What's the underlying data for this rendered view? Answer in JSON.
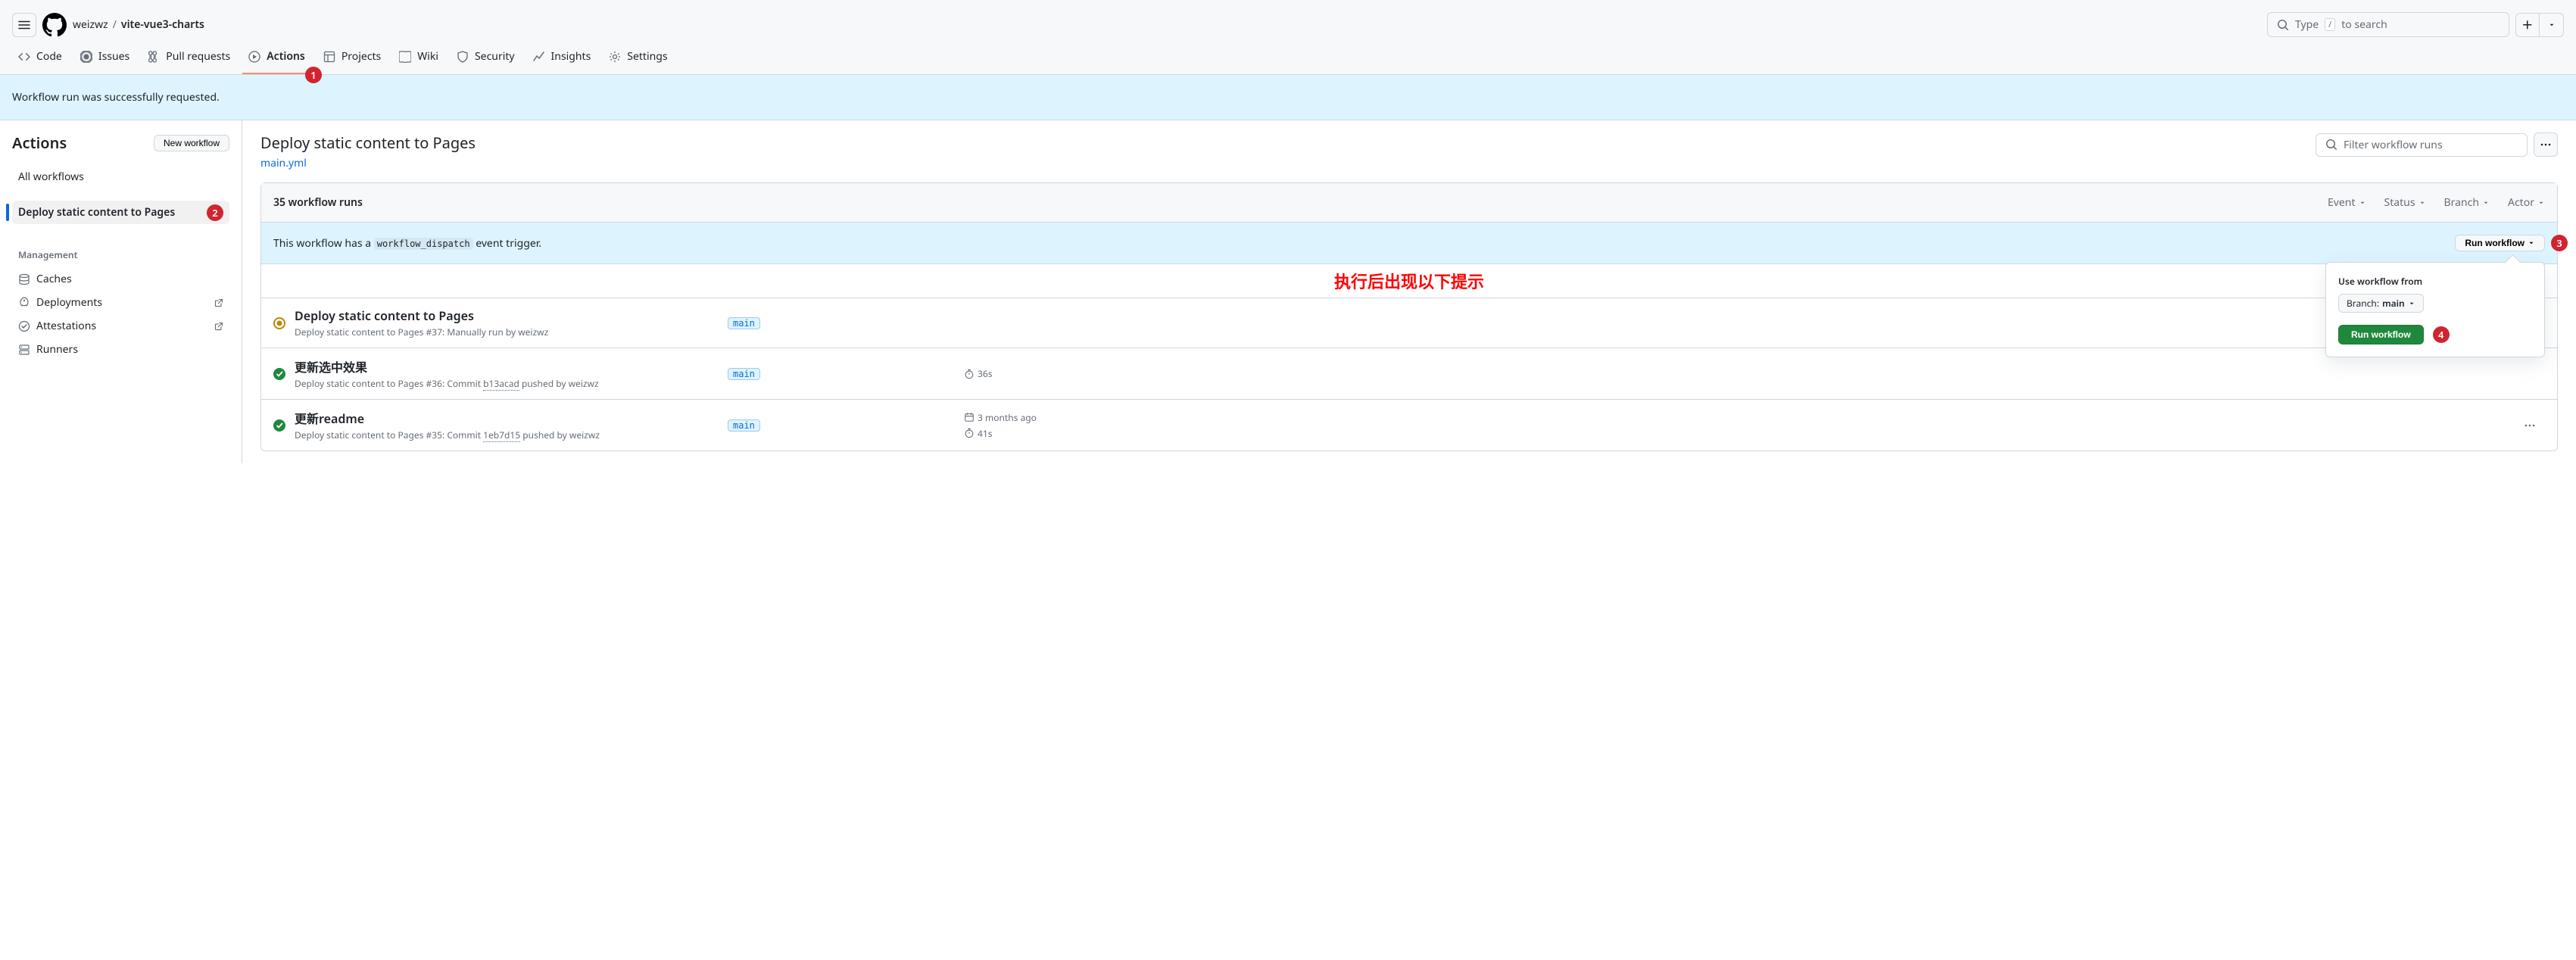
{
  "header": {
    "owner": "weizwz",
    "repo": "vite-vue3-charts",
    "search_placeholder": "Type",
    "search_hint": "to search",
    "search_key": "/"
  },
  "tabs": [
    {
      "label": "Code",
      "icon": "code"
    },
    {
      "label": "Issues",
      "icon": "issue"
    },
    {
      "label": "Pull requests",
      "icon": "pr"
    },
    {
      "label": "Actions",
      "icon": "play",
      "active": true
    },
    {
      "label": "Projects",
      "icon": "table"
    },
    {
      "label": "Wiki",
      "icon": "book"
    },
    {
      "label": "Security",
      "icon": "shield"
    },
    {
      "label": "Insights",
      "icon": "graph"
    },
    {
      "label": "Settings",
      "icon": "gear"
    }
  ],
  "banner": {
    "message": "Workflow run was successfully requested."
  },
  "sidebar": {
    "title": "Actions",
    "new_workflow": "New workflow",
    "all_workflows": "All workflows",
    "workflows": [
      {
        "label": "Deploy static content to Pages",
        "active": true
      }
    ],
    "management_title": "Management",
    "management": [
      {
        "label": "Caches",
        "icon": "cache"
      },
      {
        "label": "Deployments",
        "icon": "rocket",
        "external": true
      },
      {
        "label": "Attestations",
        "icon": "verified",
        "external": true
      },
      {
        "label": "Runners",
        "icon": "server"
      }
    ]
  },
  "main": {
    "title": "Deploy static content to Pages",
    "file": "main.yml",
    "filter_placeholder": "Filter workflow runs",
    "runs_count": "35 workflow runs",
    "filters": [
      {
        "label": "Event"
      },
      {
        "label": "Status"
      },
      {
        "label": "Branch"
      },
      {
        "label": "Actor"
      }
    ],
    "dispatch_text_prefix": "This workflow has a ",
    "dispatch_code": "workflow_dispatch",
    "dispatch_text_suffix": " event trigger.",
    "run_workflow_btn": "Run workflow",
    "overlay_annotation": "执行后出现以下提示"
  },
  "dropdown": {
    "title": "Use workflow from",
    "branch_prefix": "Branch: ",
    "branch_name": "main",
    "run_button": "Run workflow"
  },
  "runs": [
    {
      "status": "pending",
      "title": "Deploy static content to Pages",
      "sub_prefix": "Deploy static content to Pages ",
      "number": "#37",
      "sub_suffix": ": Manually run by weizwz",
      "branch": "main",
      "date": "",
      "duration": ""
    },
    {
      "status": "success",
      "title": "更新选中效果",
      "sub_prefix": "Deploy static content to Pages ",
      "number": "#36",
      "sub_mid": ": Commit ",
      "commit": "b13acad",
      "sub_suffix": " pushed by weizwz",
      "branch": "main",
      "date": "",
      "duration": "36s"
    },
    {
      "status": "success",
      "title": "更新readme",
      "sub_prefix": "Deploy static content to Pages ",
      "number": "#35",
      "sub_mid": ": Commit ",
      "commit": "1eb7d15",
      "sub_suffix": " pushed by weizwz",
      "branch": "main",
      "date": "3 months ago",
      "duration": "41s"
    }
  ],
  "badges": {
    "b1": "1",
    "b2": "2",
    "b3": "3",
    "b4": "4"
  }
}
